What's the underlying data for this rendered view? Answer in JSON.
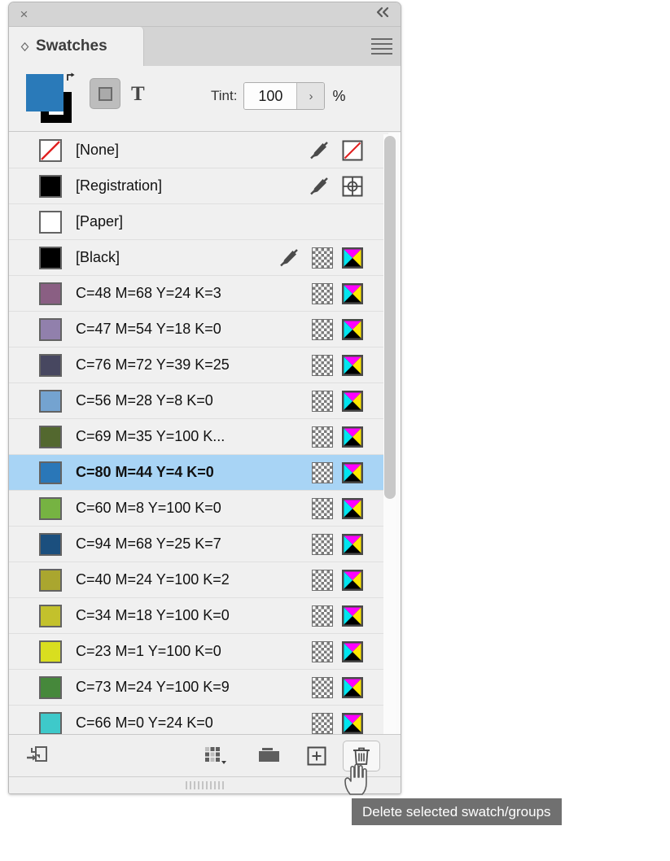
{
  "panel": {
    "title": "Swatches",
    "close_label": "×",
    "collapse_label": "«",
    "menu_name": "panel-menu-icon"
  },
  "controls": {
    "fill_color": "#2a7ab9",
    "stroke_color": "#000000",
    "tint_label": "Tint:",
    "tint_value": "100",
    "tint_unit": "%",
    "tint_arrow": "›",
    "apply_text_label": "T"
  },
  "swatches": [
    {
      "name": "[None]",
      "chip": "none",
      "chip_color": "#ffffff",
      "locked": true,
      "pattern": false,
      "mode": "none"
    },
    {
      "name": "[Registration]",
      "chip": "solid",
      "chip_color": "#000000",
      "locked": true,
      "pattern": false,
      "mode": "registration"
    },
    {
      "name": "[Paper]",
      "chip": "solid",
      "chip_color": "#ffffff",
      "locked": false,
      "pattern": false,
      "mode": ""
    },
    {
      "name": "[Black]",
      "chip": "solid",
      "chip_color": "#000000",
      "locked": true,
      "pattern": true,
      "mode": "cmyk"
    },
    {
      "name": "C=48 M=68 Y=24 K=3",
      "chip": "solid",
      "chip_color": "#8a5f83",
      "locked": false,
      "pattern": true,
      "mode": "cmyk"
    },
    {
      "name": "C=47 M=54 Y=18 K=0",
      "chip": "solid",
      "chip_color": "#9180ac",
      "locked": false,
      "pattern": true,
      "mode": "cmyk"
    },
    {
      "name": "C=76 M=72 Y=39 K=25",
      "chip": "solid",
      "chip_color": "#474760",
      "locked": false,
      "pattern": true,
      "mode": "cmyk"
    },
    {
      "name": "C=56 M=28 Y=8 K=0",
      "chip": "solid",
      "chip_color": "#74a3d0",
      "locked": false,
      "pattern": true,
      "mode": "cmyk"
    },
    {
      "name": "C=69 M=35 Y=100 K...",
      "chip": "solid",
      "chip_color": "#53682f",
      "locked": false,
      "pattern": true,
      "mode": "cmyk"
    },
    {
      "name": "C=80 M=44 Y=4 K=0",
      "chip": "solid",
      "chip_color": "#2a77b8",
      "locked": false,
      "pattern": true,
      "mode": "cmyk",
      "selected": true
    },
    {
      "name": "C=60 M=8 Y=100 K=0",
      "chip": "solid",
      "chip_color": "#76b342",
      "locked": false,
      "pattern": true,
      "mode": "cmyk"
    },
    {
      "name": "C=94 M=68 Y=25 K=7",
      "chip": "solid",
      "chip_color": "#1b4f7e",
      "locked": false,
      "pattern": true,
      "mode": "cmyk"
    },
    {
      "name": "C=40 M=24 Y=100 K=2",
      "chip": "solid",
      "chip_color": "#aaa62f",
      "locked": false,
      "pattern": true,
      "mode": "cmyk"
    },
    {
      "name": "C=34 M=18 Y=100 K=0",
      "chip": "solid",
      "chip_color": "#c3c12c",
      "locked": false,
      "pattern": true,
      "mode": "cmyk"
    },
    {
      "name": "C=23 M=1 Y=100 K=0",
      "chip": "solid",
      "chip_color": "#d9de1f",
      "locked": false,
      "pattern": true,
      "mode": "cmyk"
    },
    {
      "name": "C=73 M=24 Y=100 K=9",
      "chip": "solid",
      "chip_color": "#46883b",
      "locked": false,
      "pattern": true,
      "mode": "cmyk"
    },
    {
      "name": "C=66 M=0 Y=24 K=0",
      "chip": "solid",
      "chip_color": "#3ec9ca",
      "locked": false,
      "pattern": true,
      "mode": "cmyk"
    }
  ],
  "toolbar": {
    "library_name": "add-to-library-icon",
    "new_color_group_name": "new-color-group-icon",
    "folder_name": "color-group-folder-icon",
    "new_swatch_name": "new-swatch-icon",
    "delete_name": "delete-swatch-icon"
  },
  "tooltip": {
    "text": "Delete selected swatch/groups"
  },
  "colors": {
    "selection": "#a8d4f5",
    "panel_bg": "#f0f0f0",
    "tooltip_bg": "#707070"
  }
}
